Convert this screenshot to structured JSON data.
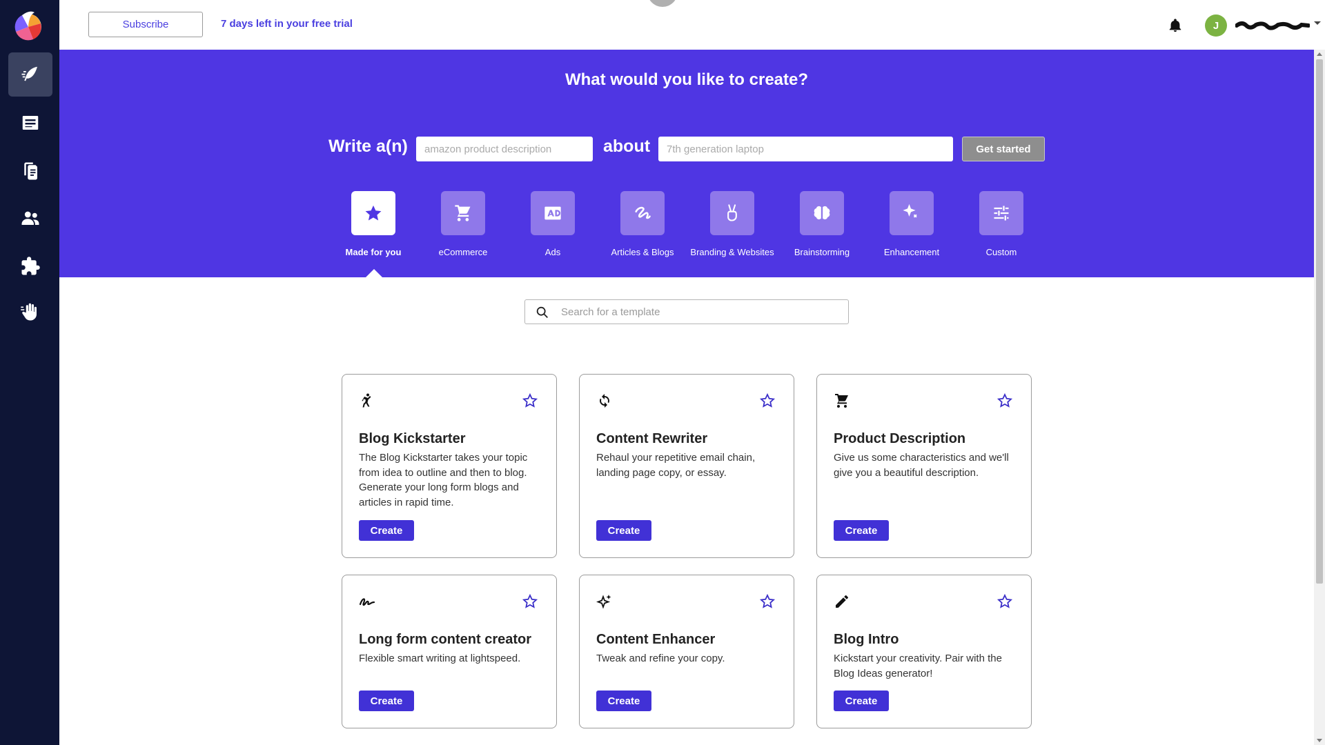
{
  "colors": {
    "sidebar": "#0e1536",
    "accent": "#4f36e3",
    "button": "#4131d6",
    "avatar": "#7cb342"
  },
  "topbar": {
    "subscribe_label": "Subscribe",
    "trial_text": "7 days left in your free trial",
    "avatar_initial": "J",
    "icons": [
      "bell-icon",
      "chevron-down-icon"
    ]
  },
  "sidebar": {
    "items": [
      {
        "icon": "quill-icon",
        "active": true
      },
      {
        "icon": "documents-icon",
        "active": false
      },
      {
        "icon": "files-icon",
        "active": false
      },
      {
        "icon": "team-icon",
        "active": false
      },
      {
        "icon": "puzzle-icon",
        "active": false
      },
      {
        "icon": "hand-icon",
        "active": false
      }
    ]
  },
  "hero": {
    "title": "What would you like to create?",
    "write_label": "Write a(n)",
    "type_placeholder": "amazon product description",
    "about_label": "about",
    "topic_placeholder": "7th generation laptop",
    "get_started_label": "Get started",
    "categories": [
      {
        "label": "Made for you",
        "icon": "star-icon",
        "active": true
      },
      {
        "label": "eCommerce",
        "icon": "cart-icon",
        "active": false
      },
      {
        "label": "Ads",
        "icon": "ad-icon",
        "active": false
      },
      {
        "label": "Articles & Blogs",
        "icon": "squiggle-icon",
        "active": false
      },
      {
        "label": "Branding & Websites",
        "icon": "victory-hand-icon",
        "active": false
      },
      {
        "label": "Brainstorming",
        "icon": "brain-icon",
        "active": false
      },
      {
        "label": "Enhancement",
        "icon": "sparkle-icon",
        "active": false
      },
      {
        "label": "Custom",
        "icon": "sliders-icon",
        "active": false
      }
    ]
  },
  "search": {
    "placeholder": "Search for a template"
  },
  "templates": [
    {
      "title": "Blog Kickstarter",
      "description": "The Blog Kickstarter takes your topic from idea to outline and then to blog. Generate your long form blogs and articles in rapid time.",
      "icon": "kick-icon",
      "create_label": "Create"
    },
    {
      "title": "Content Rewriter",
      "description": "Rehaul your repetitive email chain, landing page copy, or essay.",
      "icon": "refresh-icon",
      "create_label": "Create"
    },
    {
      "title": "Product Description",
      "description": "Give us some characteristics and we'll give you a beautiful description.",
      "icon": "cart-icon",
      "create_label": "Create"
    },
    {
      "title": "Long form content creator",
      "description": "Flexible smart writing at lightspeed.",
      "icon": "signature-icon",
      "create_label": "Create"
    },
    {
      "title": "Content Enhancer",
      "description": "Tweak and refine your copy.",
      "icon": "sparkles-icon",
      "create_label": "Create"
    },
    {
      "title": "Blog Intro",
      "description": "Kickstart your creativity. Pair with the Blog Ideas generator!",
      "icon": "pencil-icon",
      "create_label": "Create"
    }
  ]
}
